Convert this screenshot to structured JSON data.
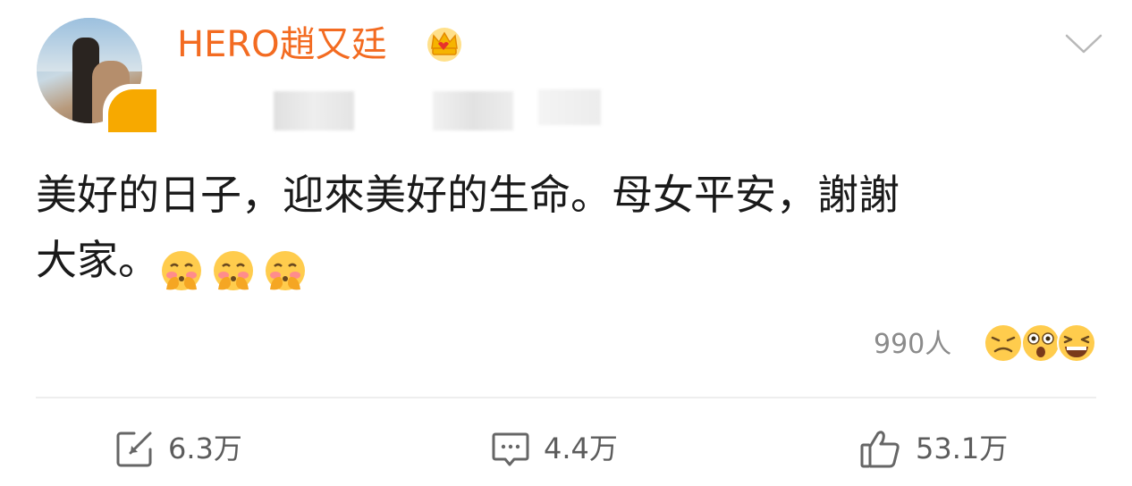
{
  "post": {
    "author": {
      "name": "HERO趙又廷",
      "badge": "crown-icon"
    },
    "content": {
      "line1": "美好的日子，迎來美好的生命。母女平安，謝謝",
      "line2": "大家。",
      "emojis": [
        "blush-face-icon",
        "blush-face-icon",
        "blush-face-icon"
      ]
    },
    "reactions": {
      "count": "990人",
      "faces": [
        "grimace-face-icon",
        "shocked-face-icon",
        "laughing-face-icon"
      ]
    },
    "actions": {
      "repost": "6.3万",
      "comment": "4.4万",
      "like": "53.1万"
    }
  },
  "colors": {
    "username": "#f36b21",
    "text": "#1a1a1a",
    "muted": "#8b8b8b",
    "action": "#5c5c5c",
    "badge": "#f7a900"
  }
}
